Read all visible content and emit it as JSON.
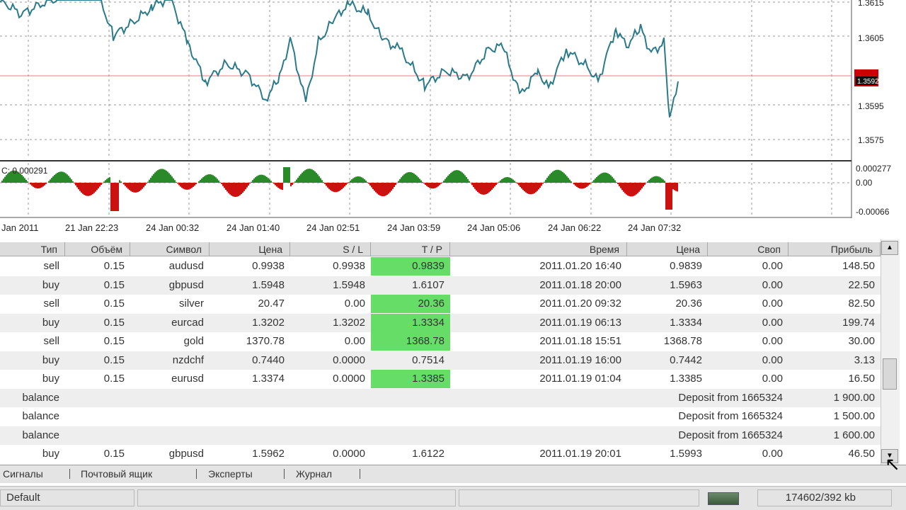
{
  "chart": {
    "price_axis": [
      "1.3615",
      "1.3605",
      "1.3595",
      "1.3575"
    ],
    "current_price": "1.3592",
    "indicator_label": "C: 0.000291",
    "indicator_axis": [
      "0.000277",
      "0.00",
      "-0.00066"
    ],
    "time_labels": [
      "Jan 2011",
      "21 Jan 22:23",
      "24 Jan 00:32",
      "24 Jan 01:40",
      "24 Jan 02:51",
      "24 Jan 03:59",
      "24 Jan 05:06",
      "24 Jan 06:22",
      "24 Jan 07:32"
    ],
    "colors": {
      "price_line": "#2a7a8a",
      "hist_up": "#2a8a2a",
      "hist_down": "#cc1111",
      "level_line": "#e08080",
      "grid": "#9a9a9a",
      "price_tag": "#cc0000"
    }
  },
  "table": {
    "headers": [
      "Тип",
      "Объём",
      "Символ",
      "Цена",
      "S / L",
      "T / P",
      "Время",
      "Цена",
      "Своп",
      "Прибыль"
    ],
    "rows": [
      {
        "type": "sell",
        "volume": "0.15",
        "symbol": "audusd",
        "price": "0.9938",
        "sl": "0.9938",
        "tp": "0.9839",
        "time": "2011.01.20 16:40",
        "close": "0.9839",
        "swap": "0.00",
        "profit": "148.50",
        "tp_hit": true
      },
      {
        "type": "buy",
        "volume": "0.15",
        "symbol": "gbpusd",
        "price": "1.5948",
        "sl": "1.5948",
        "tp": "1.6107",
        "time": "2011.01.18 20:00",
        "close": "1.5963",
        "swap": "0.00",
        "profit": "22.50",
        "tp_hit": false
      },
      {
        "type": "sell",
        "volume": "0.15",
        "symbol": "silver",
        "price": "20.47",
        "sl": "0.00",
        "tp": "20.36",
        "time": "2011.01.20 09:32",
        "close": "20.36",
        "swap": "0.00",
        "profit": "82.50",
        "tp_hit": true
      },
      {
        "type": "buy",
        "volume": "0.15",
        "symbol": "eurcad",
        "price": "1.3202",
        "sl": "1.3202",
        "tp": "1.3334",
        "time": "2011.01.19 06:13",
        "close": "1.3334",
        "swap": "0.00",
        "profit": "199.74",
        "tp_hit": true
      },
      {
        "type": "sell",
        "volume": "0.15",
        "symbol": "gold",
        "price": "1370.78",
        "sl": "0.00",
        "tp": "1368.78",
        "time": "2011.01.18 15:51",
        "close": "1368.78",
        "swap": "0.00",
        "profit": "30.00",
        "tp_hit": true
      },
      {
        "type": "buy",
        "volume": "0.15",
        "symbol": "nzdchf",
        "price": "0.7440",
        "sl": "0.0000",
        "tp": "0.7514",
        "time": "2011.01.19 16:00",
        "close": "0.7442",
        "swap": "0.00",
        "profit": "3.13",
        "tp_hit": false
      },
      {
        "type": "buy",
        "volume": "0.15",
        "symbol": "eurusd",
        "price": "1.3374",
        "sl": "0.0000",
        "tp": "1.3385",
        "time": "2011.01.19 01:04",
        "close": "1.3385",
        "swap": "0.00",
        "profit": "16.50",
        "tp_hit": true
      },
      {
        "type": "balance",
        "comment": "Deposit from 1665324",
        "profit": "1 900.00"
      },
      {
        "type": "balance",
        "comment": "Deposit from 1665324",
        "profit": "1 500.00"
      },
      {
        "type": "balance",
        "comment": "Deposit from 1665324",
        "profit": "1 600.00"
      },
      {
        "type": "buy",
        "volume": "0.15",
        "symbol": "gbpusd",
        "price": "1.5962",
        "sl": "0.0000",
        "tp": "1.6122",
        "time": "2011.01.19 20:01",
        "close": "1.5993",
        "swap": "0.00",
        "profit": "46.50",
        "tp_hit": false
      }
    ]
  },
  "tabs": [
    "Сигналы",
    "Почтовый ящик",
    "Эксперты",
    "Журнал"
  ],
  "status": {
    "profile": "Default",
    "traffic": "174602/392 kb"
  },
  "icons": {
    "scroll_up": "scroll-up-icon",
    "scroll_down": "scroll-down-icon",
    "connection": "connection-bars-icon",
    "cursor": "mouse-cursor-icon"
  }
}
